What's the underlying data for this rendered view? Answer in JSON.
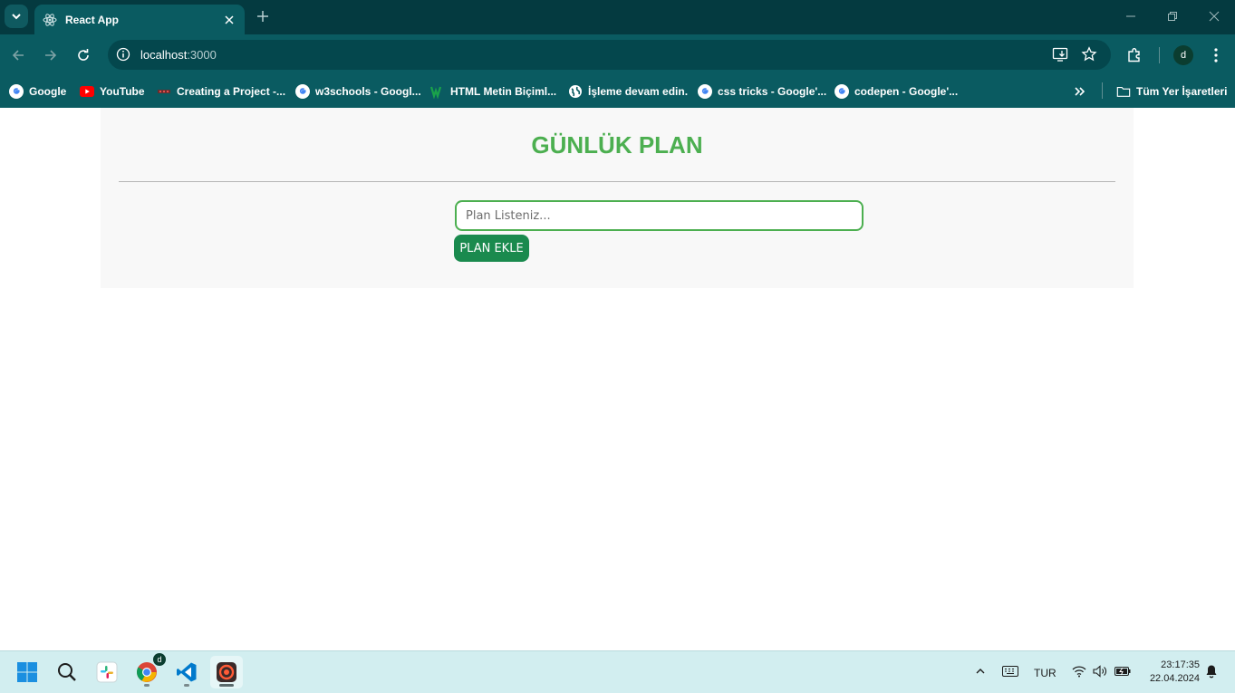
{
  "browser": {
    "tab_title": "React App",
    "url_host": "localhost",
    "url_rest": ":3000",
    "profile_initial": "d",
    "bookmarks": [
      {
        "label": "Google",
        "icon": "google-icon"
      },
      {
        "label": "YouTube",
        "icon": "youtube-icon"
      },
      {
        "label": "Creating a Project -...",
        "icon": "site-icon"
      },
      {
        "label": "w3schools - Googl...",
        "icon": "google-icon"
      },
      {
        "label": "HTML Metin Biçiml...",
        "icon": "site-icon"
      },
      {
        "label": "İşleme devam edin.",
        "icon": "globe-icon"
      },
      {
        "label": "css tricks - Google'...",
        "icon": "google-icon"
      },
      {
        "label": "codepen - Google'...",
        "icon": "google-icon"
      }
    ],
    "all_bookmarks_label": "Tüm Yer İşaretleri"
  },
  "app": {
    "heading": "GÜNLÜK PLAN",
    "input_placeholder": "Plan Listeniz...",
    "input_value": "",
    "add_button_label": "PLAN EKLE",
    "accent_color": "#4caf50",
    "button_color": "#1a8a4e"
  },
  "taskbar": {
    "apps": [
      "windows-start-icon",
      "search-icon",
      "slack-icon",
      "chrome-icon",
      "vscode-icon",
      "recorder-icon"
    ],
    "chrome_badge": "d",
    "language": "TUR",
    "time": "23:17:35",
    "date": "22.04.2024"
  }
}
